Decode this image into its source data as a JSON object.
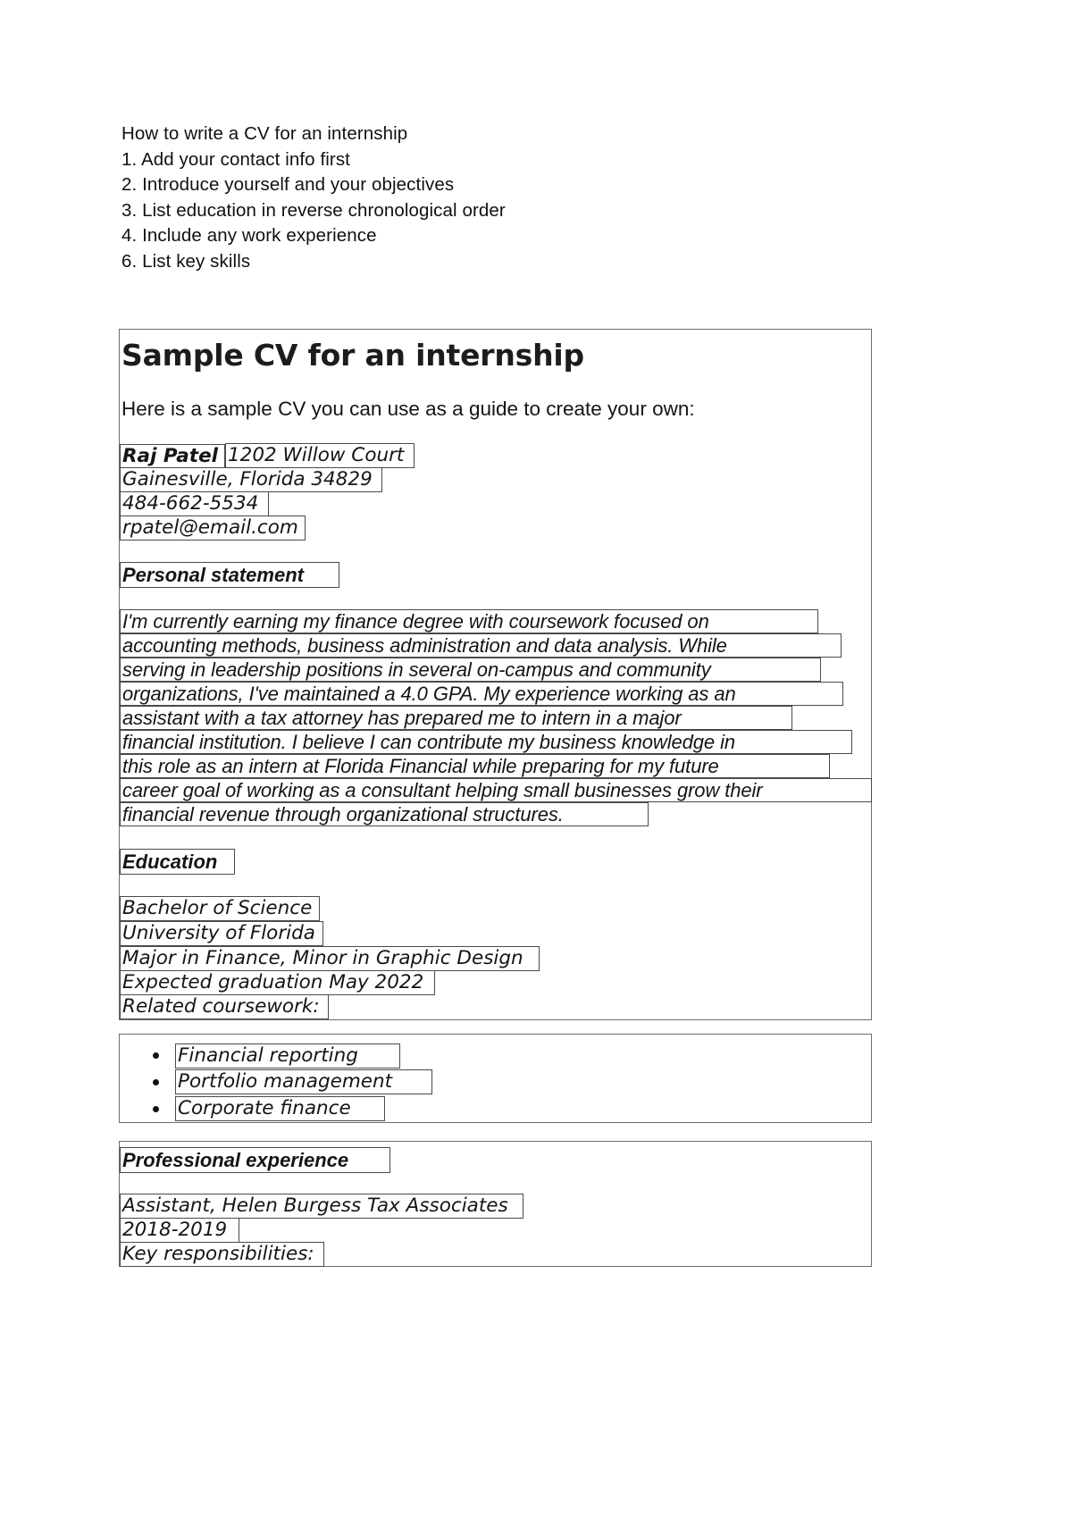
{
  "document": {
    "intro_list": [
      "How to write a CV for an internship",
      "1. Add your contact info first",
      "2. Introduce yourself and your objectives",
      "3. List education in reverse chronological order",
      "4. Include any work experience",
      "6. List key skills"
    ],
    "cv": {
      "title": "Sample CV for an internship",
      "intro": "Here is a sample CV you can use as a guide to create your own:",
      "name": "Raj Patel",
      "address_street": "1202 Willow Court",
      "address_city": "Gainesville, Florida 34829",
      "phone": "484-662-5534",
      "email": "rpatel@email.com",
      "personal_statement_heading": "Personal statement",
      "personal_statement_lines": [
        "I'm currently earning my finance degree with coursework focused on",
        "accounting methods, business administration and data analysis. While",
        "serving in leadership positions in several on-campus and community",
        "organizations, I've maintained a 4.0 GPA. My experience working as an",
        "assistant with a tax attorney has prepared me to intern in a major",
        "financial institution. I believe I can contribute my business knowledge in",
        "this role as an intern at Florida Financial while preparing for my future",
        "career goal of working as a consultant helping small businesses grow their",
        "financial revenue through organizational structures."
      ],
      "education_heading": "Education",
      "education_lines": [
        "Bachelor of Science",
        "University of Florida",
        "Major in Finance, Minor in Graphic Design",
        "Expected graduation May 2022",
        "Related coursework:"
      ],
      "coursework_bullets": [
        "Financial reporting",
        "Portfolio management",
        "Corporate finance"
      ],
      "experience_heading": "Professional experience",
      "experience_lines": [
        "Assistant, Helen Burgess Tax Associates",
        "2018-2019",
        "Key responsibilities:"
      ]
    }
  },
  "colors": {
    "text": "#151515",
    "box_border": "#4a4a4a",
    "container_border": "#6d6d6d",
    "background": "#ffffff"
  }
}
